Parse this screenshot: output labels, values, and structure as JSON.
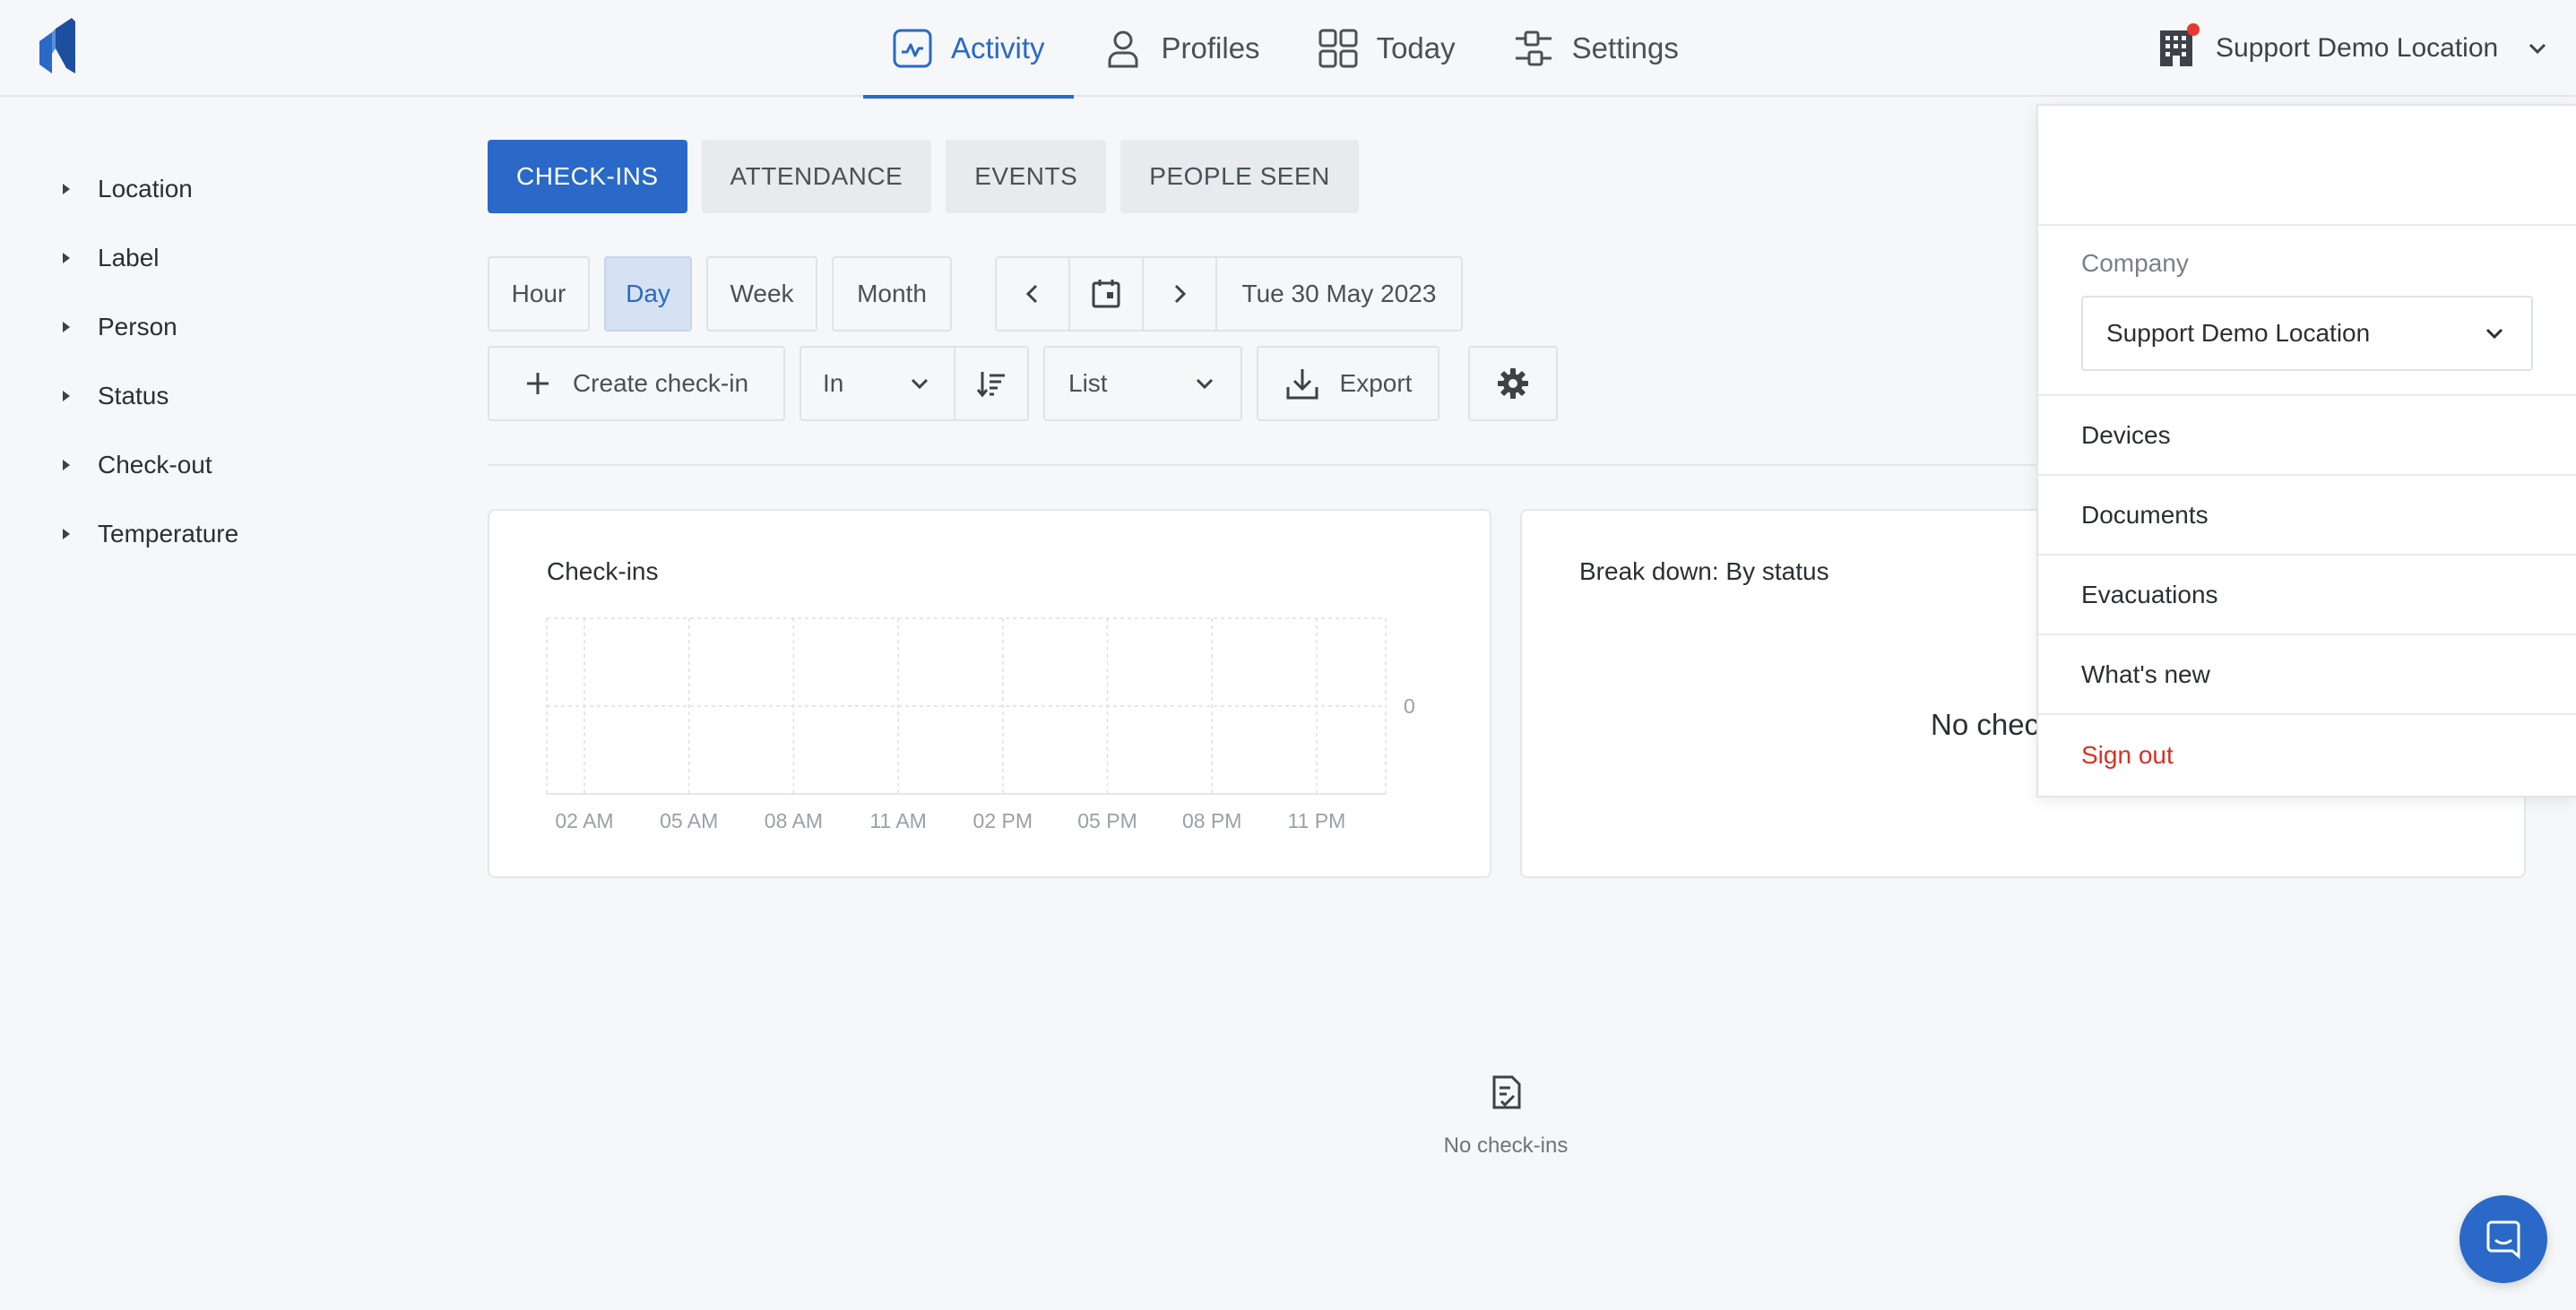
{
  "nav": {
    "items": [
      {
        "label": "Activity",
        "icon": "activity-icon",
        "active": true
      },
      {
        "label": "Profiles",
        "icon": "person-icon"
      },
      {
        "label": "Today",
        "icon": "grid-icon"
      },
      {
        "label": "Settings",
        "icon": "sliders-icon"
      }
    ],
    "location": "Support Demo Location"
  },
  "filters": [
    "Location",
    "Label",
    "Person",
    "Status",
    "Check-out",
    "Temperature"
  ],
  "tabs": [
    "CHECK-INS",
    "ATTENDANCE",
    "EVENTS",
    "PEOPLE SEEN"
  ],
  "period": {
    "options": [
      "Hour",
      "Day",
      "Week",
      "Month"
    ],
    "selected": "Day",
    "date": "Tue 30 May 2023"
  },
  "actions": {
    "create": "Create check-in",
    "direction": "In",
    "view": "List",
    "export": "Export"
  },
  "chart_data": {
    "type": "bar",
    "title": "Check-ins",
    "categories": [
      "02 AM",
      "05 AM",
      "08 AM",
      "11 AM",
      "02 PM",
      "05 PM",
      "08 PM",
      "11 PM"
    ],
    "values": [
      0,
      0,
      0,
      0,
      0,
      0,
      0,
      0
    ],
    "yticks": [
      "0"
    ],
    "grid": true
  },
  "breakdown": {
    "title": "Break down: By status",
    "empty_text": "No chec"
  },
  "empty_state": {
    "label": "No check-ins"
  },
  "menu": {
    "company_label": "Company",
    "company_value": "Support Demo Location",
    "items": [
      "Devices",
      "Documents",
      "Evacuations",
      "What's new"
    ],
    "signout": "Sign out"
  },
  "colors": {
    "primary": "#2a69c7",
    "danger": "#d93025",
    "notification": "#e63a2e"
  }
}
